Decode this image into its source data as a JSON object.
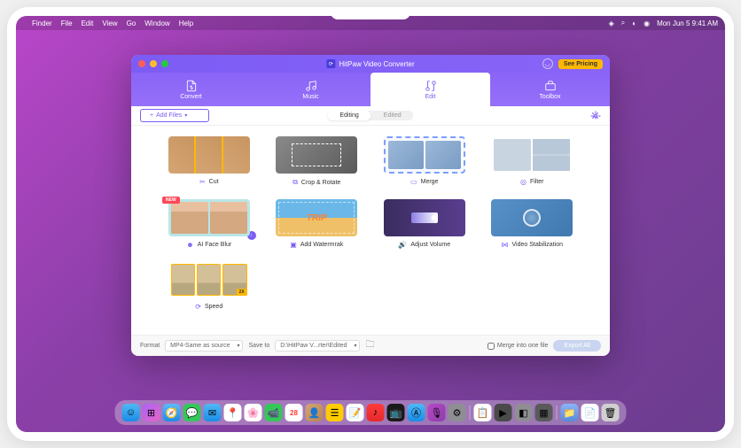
{
  "menubar": {
    "app": "Finder",
    "items": [
      "File",
      "Edit",
      "View",
      "Go",
      "Window",
      "Help"
    ],
    "datetime": "Mon Jun 5  9:41 AM"
  },
  "window": {
    "title": "HitPaw Video Converter",
    "pricing_label": "See Pricing"
  },
  "main_tabs": {
    "convert": "Convert",
    "music": "Music",
    "edit": "Edit",
    "toolbox": "Toolbox"
  },
  "sub_header": {
    "add_files": "Add Files",
    "tabs": {
      "editing": "Editing",
      "edited": "Edited"
    }
  },
  "tools": {
    "cut": "Cut",
    "crop": "Crop & Rotate",
    "merge": "Merge",
    "filter": "Filter",
    "faceblur": "AI Face Blur",
    "watermark": "Add Watermrak",
    "volume": "Adjust Volume",
    "stabilize": "Video Stabilization",
    "speed": "Speed",
    "new_badge": "NEW",
    "watermark_text": "TRIP"
  },
  "footer": {
    "format_label": "Format",
    "format_value": "MP4-Same as source",
    "saveto_label": "Save to",
    "saveto_value": "D:\\HitPaw V...rter\\Edited",
    "merge_label": "Merge into one file",
    "export_label": "Export All"
  }
}
